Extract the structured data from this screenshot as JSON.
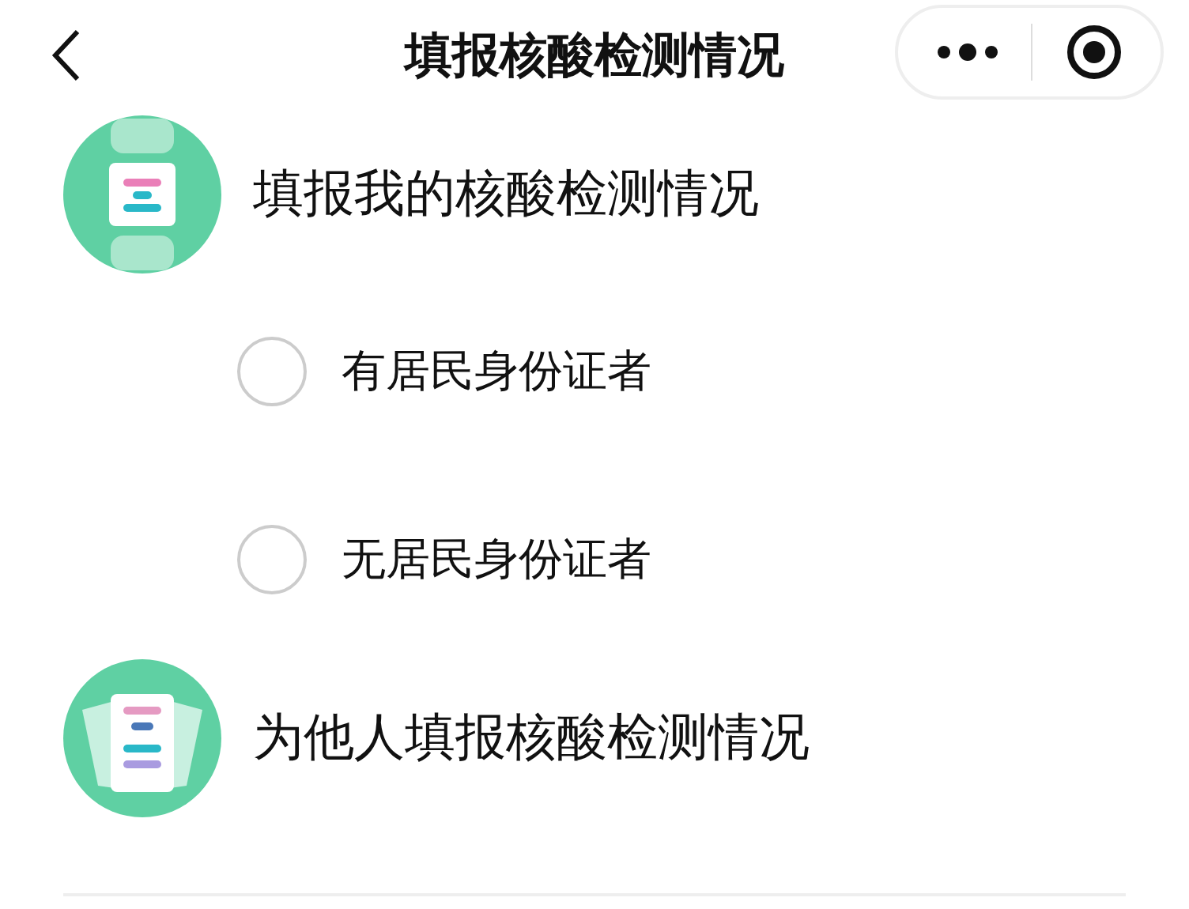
{
  "nav": {
    "title": "填报核酸检测情况"
  },
  "sections": [
    {
      "kind": "self",
      "label": "填报我的核酸检测情况",
      "options": [
        {
          "label": "有居民身份证者",
          "selected": false
        },
        {
          "label": "无居民身份证者",
          "selected": false
        }
      ]
    },
    {
      "kind": "others",
      "label": "为他人填报核酸检测情况"
    }
  ]
}
